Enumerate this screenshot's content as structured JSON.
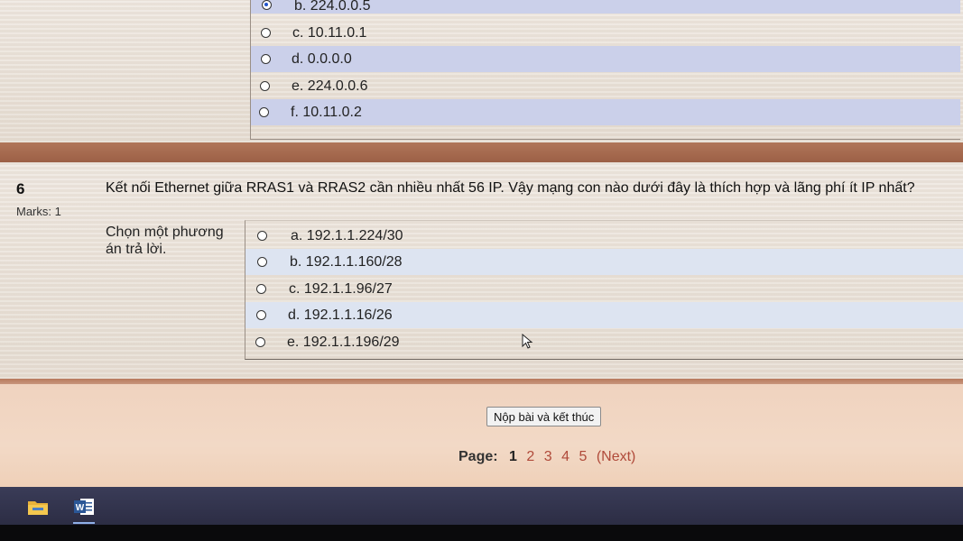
{
  "question5": {
    "options": [
      {
        "label": "b. 224.0.0.5",
        "selected": true
      },
      {
        "label": "c. 10.11.0.1",
        "selected": false
      },
      {
        "label": "d. 0.0.0.0",
        "selected": false
      },
      {
        "label": "e. 224.0.0.6",
        "selected": false
      },
      {
        "label": "f. 10.11.0.2",
        "selected": false
      }
    ]
  },
  "question6": {
    "number": "6",
    "marks": "Marks: 1",
    "text": "Kết nối Ethernet giữa RRAS1 và RRAS2 cần nhiều nhất 56 IP. Vậy mạng con nào dưới đây là thích hợp và lãng phí ít IP nhất?",
    "prompt": "Chọn một phương án trả lời.",
    "options": [
      {
        "label": "a. 192.1.1.224/30",
        "selected": false
      },
      {
        "label": "b. 192.1.1.160/28",
        "selected": false
      },
      {
        "label": "c. 192.1.1.96/27",
        "selected": false
      },
      {
        "label": "d. 192.1.1.16/26",
        "selected": false
      },
      {
        "label": "e. 192.1.1.196/29",
        "selected": false
      }
    ]
  },
  "footer": {
    "submit_label": "Nộp bài và kết thúc",
    "page_label": "Page:",
    "current_page": "1",
    "pages": [
      "2",
      "3",
      "4",
      "5"
    ],
    "next_label": "(Next)"
  },
  "taskbar": {
    "apps": [
      {
        "icon": "file-explorer-icon"
      },
      {
        "icon": "word-icon"
      }
    ]
  },
  "colors": {
    "option_band_q5": "#cbd0ea",
    "option_band_q6": "#dde4f1",
    "separator": "#a86a4f",
    "footer_bg": "#f2d9c6",
    "link": "#b04a3a",
    "taskbar": "#33344e"
  }
}
